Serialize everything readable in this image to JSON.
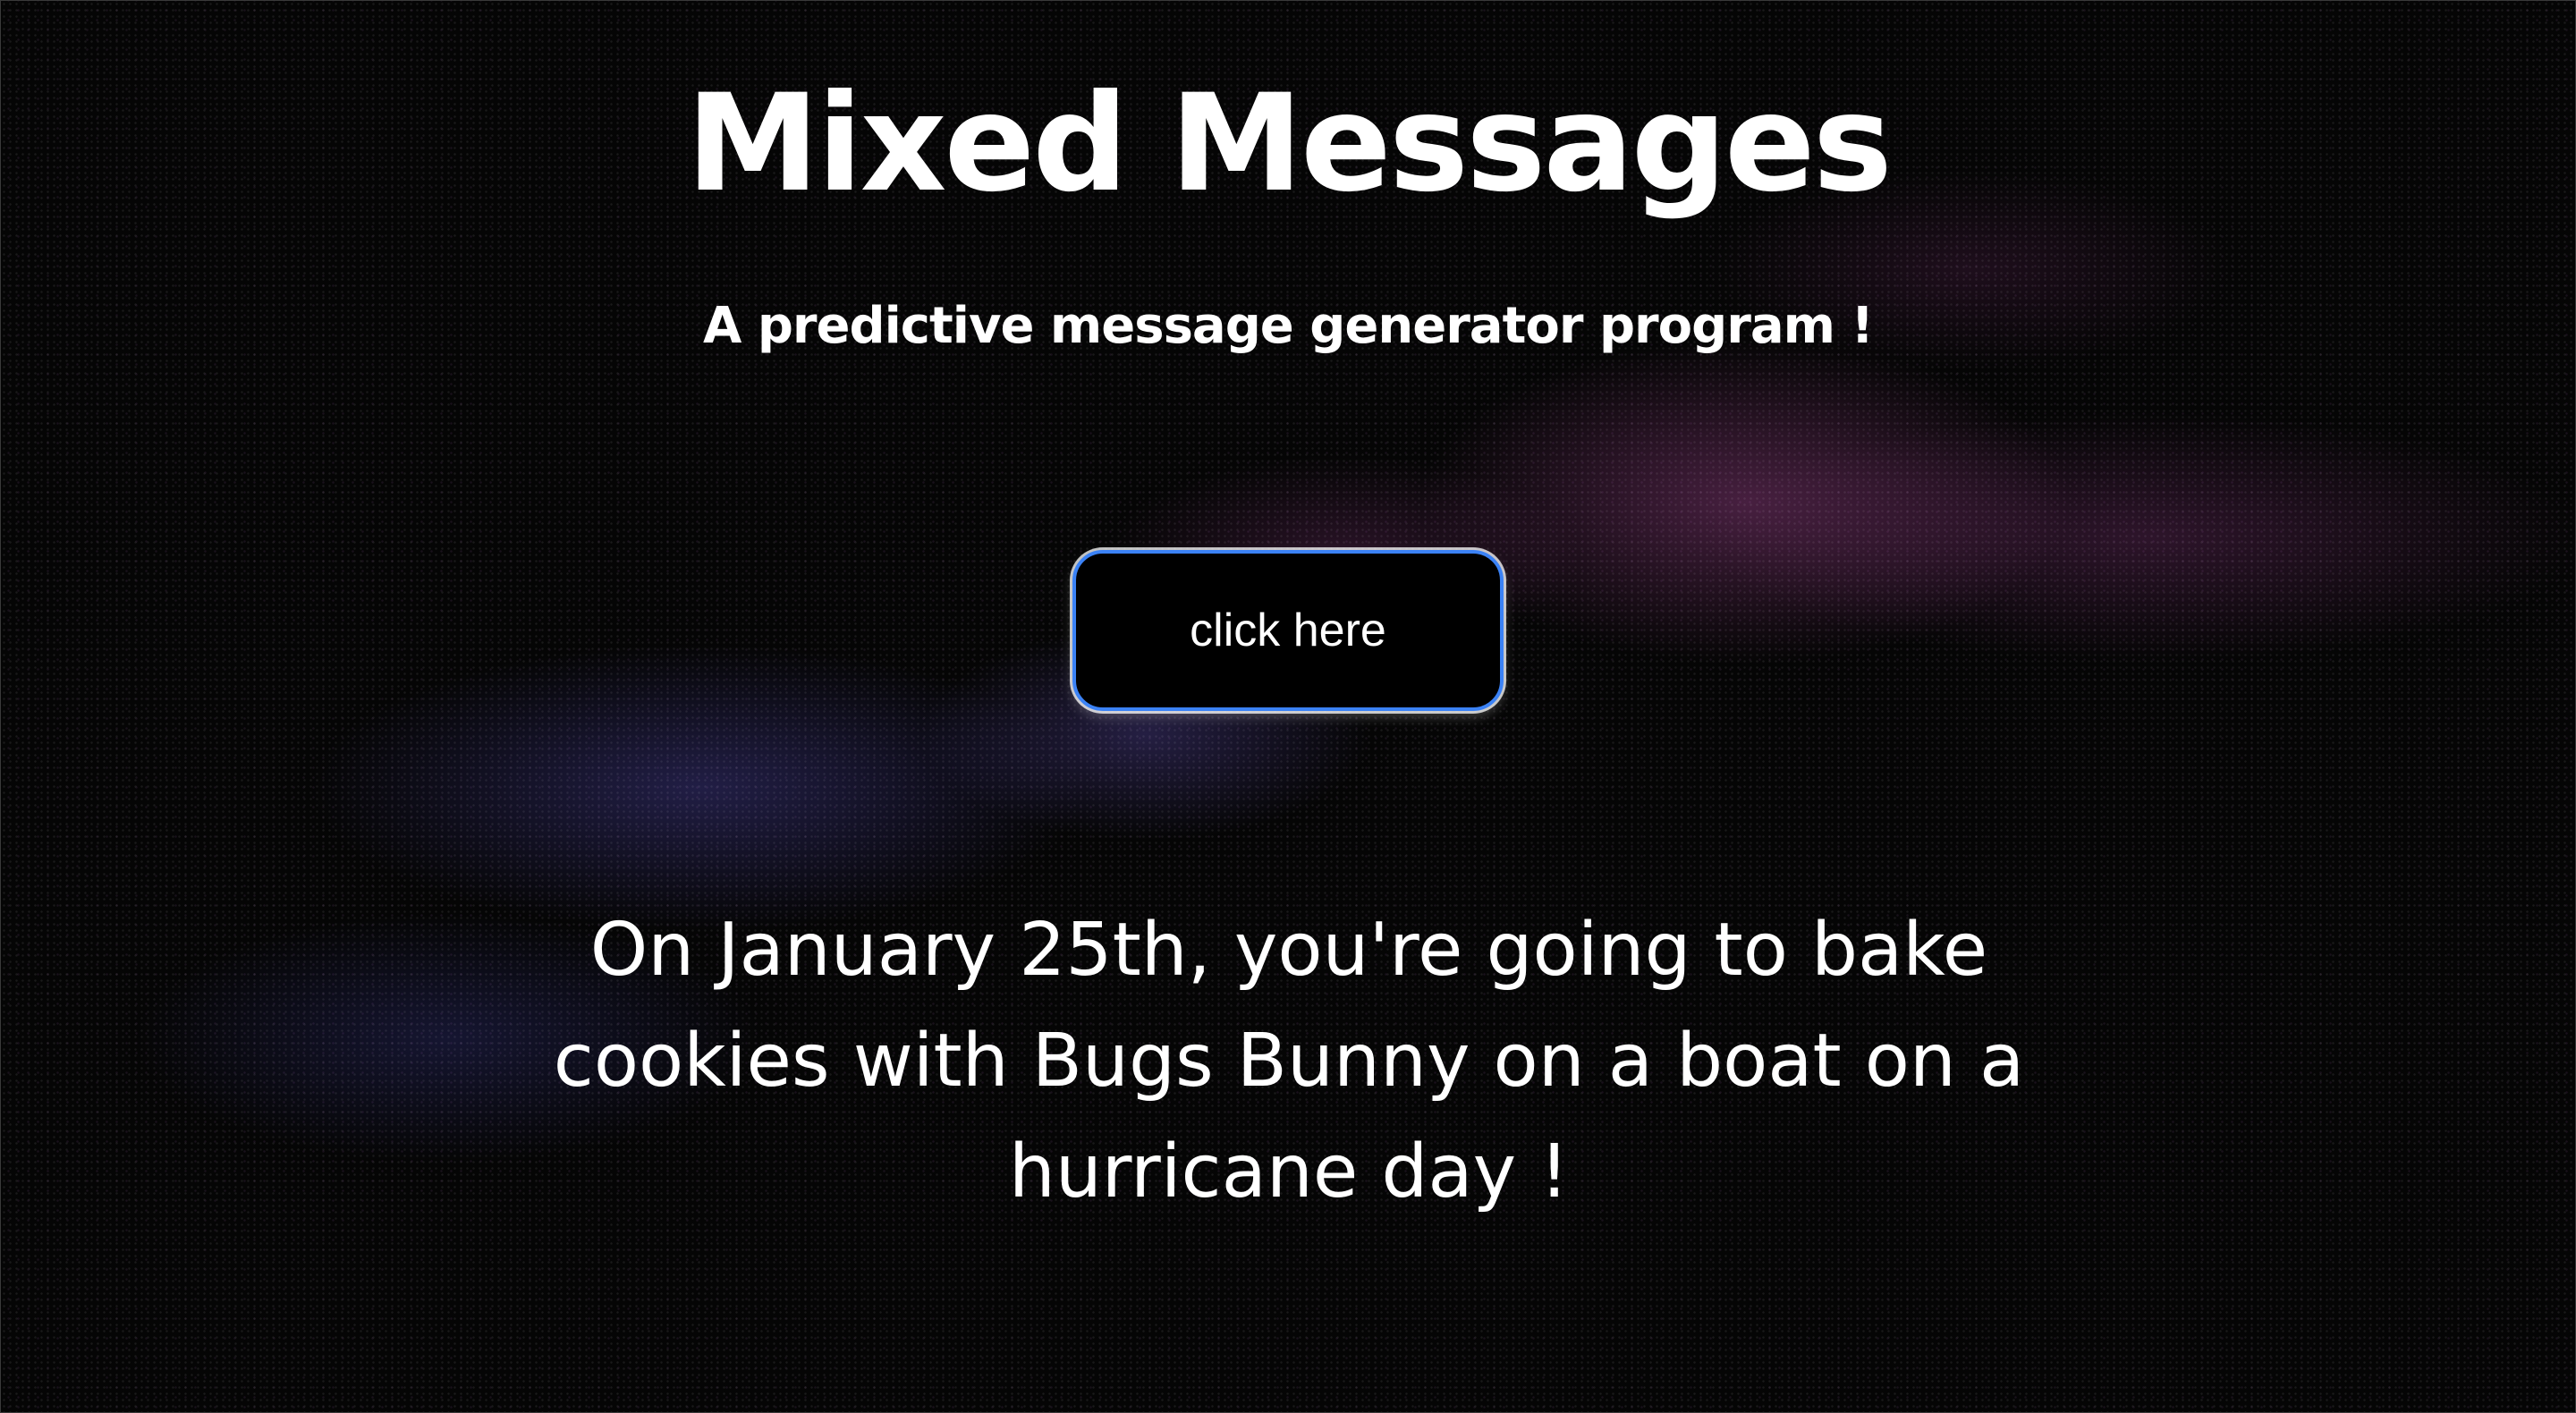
{
  "header": {
    "title": "Mixed Messages",
    "subtitle": "A predictive message generator program !"
  },
  "actions": {
    "generate_label": "click here"
  },
  "output": {
    "message": "On January 25th, you're going to bake cookies with Bugs Bunny on a boat on a hurricane day !"
  },
  "colors": {
    "background": "#050505",
    "text": "#ffffff",
    "button_border": "#3b82f6",
    "nebula_pink": "#a84696",
    "nebula_blue": "#5a50c8"
  }
}
